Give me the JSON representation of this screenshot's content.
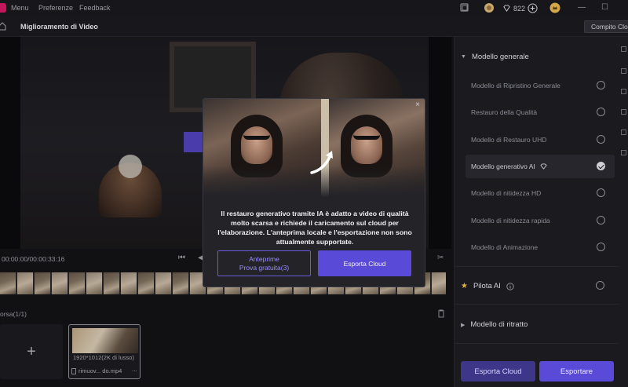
{
  "titlebar": {
    "menus": [
      "Menu",
      "Preferenze",
      "Feedback"
    ],
    "credits": "822",
    "icons": [
      "app-logo-icon",
      "device-icon",
      "coin-icon",
      "diamond-icon",
      "plus-circle-icon",
      "user-crown-icon",
      "minimize-icon",
      "maximize-icon"
    ]
  },
  "header": {
    "title": "Miglioramento di Video",
    "tooltip": "Compito Cloud"
  },
  "timeline": {
    "timecode": "00:00:00/00:00:33:16"
  },
  "queue": {
    "label": "orsa(1/1)",
    "add_symbol": "+",
    "clip": {
      "resolution": "1920*1012(2K di lusso)",
      "name": "rimuov... do.mp4",
      "more": "..."
    }
  },
  "panel": {
    "general_section": "Modello generale",
    "options": [
      {
        "label": "Modello di Ripristino Generale",
        "selected": false
      },
      {
        "label": "Restauro della Qualità",
        "selected": false
      },
      {
        "label": "Modello di Restauro UHD",
        "selected": false
      },
      {
        "label": "Modello generativo AI",
        "selected": true
      },
      {
        "label": "Modello di nitidezza HD",
        "selected": false
      },
      {
        "label": "Modello di nitidezza rapida",
        "selected": false
      },
      {
        "label": "Modello di Animazione",
        "selected": false
      }
    ],
    "pilot_label": "Pilota AI",
    "portrait_section": "Modello di ritratto",
    "cloud_button": "Esporta Cloud",
    "export_button": "Esportare",
    "colors": {
      "accent": "#5a4ad8",
      "accent_dark": "#3e3688"
    }
  },
  "modal": {
    "message": "Il restauro generativo tramite IA è adatto a video di qualità molto scarsa e richiede il caricamento sul cloud per l'elaborazione. L'anteprima locale e l'esportazione non sono attualmente supportate.",
    "preview_button_line1": "Anteprime",
    "preview_button_line2": "Prova gratuita(3)",
    "cloud_button": "Esporta Cloud",
    "close": "×"
  }
}
